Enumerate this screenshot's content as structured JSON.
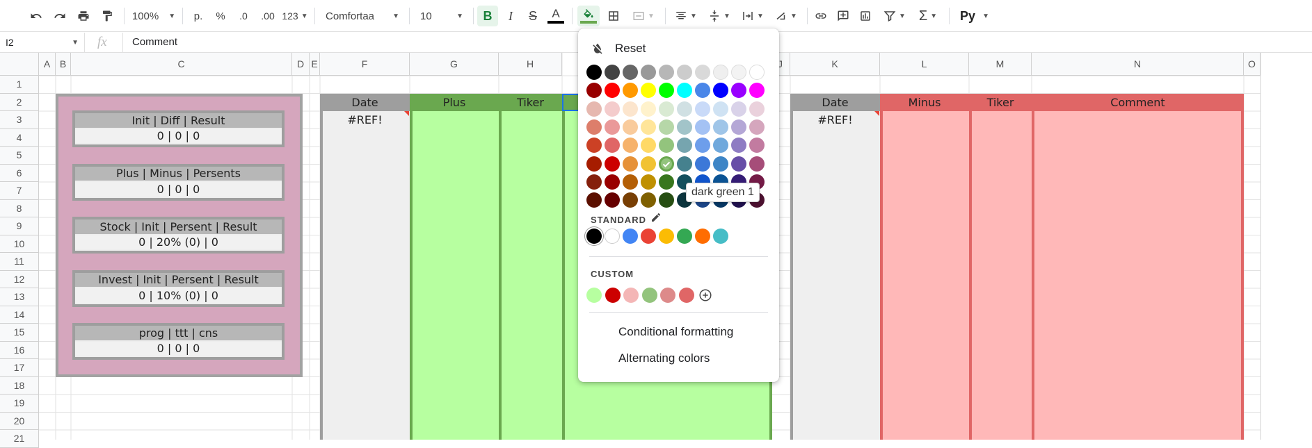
{
  "toolbar": {
    "zoom": "100%",
    "currency": "р.",
    "percent": "%",
    "dec_less": ".0",
    "dec_more": ".00",
    "more_formats": "123",
    "font": "Comfortaa",
    "font_size": "10",
    "bold": "B",
    "italic": "I",
    "strike": "S",
    "text_color": "A",
    "ext": "Py"
  },
  "formula_bar": {
    "name_box": "I2",
    "fx": "fx",
    "content": "Comment"
  },
  "columns": [
    "A",
    "B",
    "C",
    "D",
    "E",
    "F",
    "G",
    "H",
    "J",
    "K",
    "L",
    "M",
    "N",
    "O"
  ],
  "rows": [
    "1",
    "2",
    "3",
    "4",
    "5",
    "6",
    "7",
    "8",
    "9",
    "10",
    "11",
    "12",
    "13",
    "14",
    "15",
    "16",
    "17",
    "18",
    "19",
    "20",
    "21"
  ],
  "summary_blocks": [
    {
      "header": "Init | Diff | Result",
      "value": "0 | 0 | 0"
    },
    {
      "header": "Plus | Minus | Persents",
      "value": "0 | 0 | 0"
    },
    {
      "header": "Stock | Init | Persent | Result",
      "value": "0 | 20% (0) | 0"
    },
    {
      "header": "Invest | Init | Persent | Result",
      "value": "0 | 10% (0) | 0"
    },
    {
      "header": "prog | ttt | cns",
      "value": "0 | 0 | 0"
    }
  ],
  "plus_table": {
    "date": "Date",
    "plus": "Plus",
    "tiker": "Tiker",
    "ref": "#REF!"
  },
  "minus_table": {
    "date": "Date",
    "minus": "Minus",
    "tiker": "Tiker",
    "comment": "Comment",
    "ref": "#REF!"
  },
  "palette": {
    "reset": "Reset",
    "standard": "STANDARD",
    "custom": "CUSTOM",
    "conditional": "Conditional formatting",
    "alternating": "Alternating colors",
    "tooltip": "dark green 1",
    "grid": [
      [
        "#000000",
        "#434343",
        "#666666",
        "#999999",
        "#b7b7b7",
        "#cccccc",
        "#d9d9d9",
        "#efefef",
        "#f3f3f3",
        "#ffffff"
      ],
      [
        "#980000",
        "#ff0000",
        "#ff9900",
        "#ffff00",
        "#00ff00",
        "#00ffff",
        "#4a86e8",
        "#0000ff",
        "#9900ff",
        "#ff00ff"
      ],
      [
        "#e6b8af",
        "#f4cccc",
        "#fce5cd",
        "#fff2cc",
        "#d9ead3",
        "#d0e0e3",
        "#c9daf8",
        "#cfe2f3",
        "#d9d2e9",
        "#ead1dc"
      ],
      [
        "#dd7e6b",
        "#ea9999",
        "#f9cb9c",
        "#ffe599",
        "#b6d7a8",
        "#a2c4c9",
        "#a4c2f4",
        "#9fc5e8",
        "#b4a7d6",
        "#d5a6bd"
      ],
      [
        "#cc4125",
        "#e06666",
        "#f6b26b",
        "#ffd966",
        "#93c47d",
        "#76a5af",
        "#6d9eeb",
        "#6fa8dc",
        "#8e7cc3",
        "#c27ba0"
      ],
      [
        "#a61c00",
        "#cc0000",
        "#e69138",
        "#f1c232",
        "#6aa84f",
        "#45818e",
        "#3c78d8",
        "#3d85c6",
        "#674ea7",
        "#a64d79"
      ],
      [
        "#85200c",
        "#990000",
        "#b45f06",
        "#bf9000",
        "#38761d",
        "#134f5c",
        "#1155cc",
        "#0b5394",
        "#351c75",
        "#741b47"
      ],
      [
        "#5b0f00",
        "#660000",
        "#783f04",
        "#7f6000",
        "#274e13",
        "#0c343d",
        "#1c4587",
        "#073763",
        "#20124d",
        "#4c1130"
      ]
    ],
    "standard_colors": [
      "#000000",
      "#ffffff",
      "#4285f4",
      "#ea4335",
      "#fbbc04",
      "#34a853",
      "#ff6d01",
      "#46bdc6"
    ],
    "custom_colors": [
      "#b7ffa0",
      "#cc0000",
      "#f4b6b6",
      "#93c47d",
      "#dd8a8a",
      "#e06666"
    ]
  },
  "colors": {
    "pink_block": "#d5a6bd",
    "gray_header": "#9e9e9e",
    "green_header": "#6aa84f",
    "green_fill": "#b7ffa0",
    "red_header": "#e06666",
    "red_fill": "#ffb8b8"
  }
}
